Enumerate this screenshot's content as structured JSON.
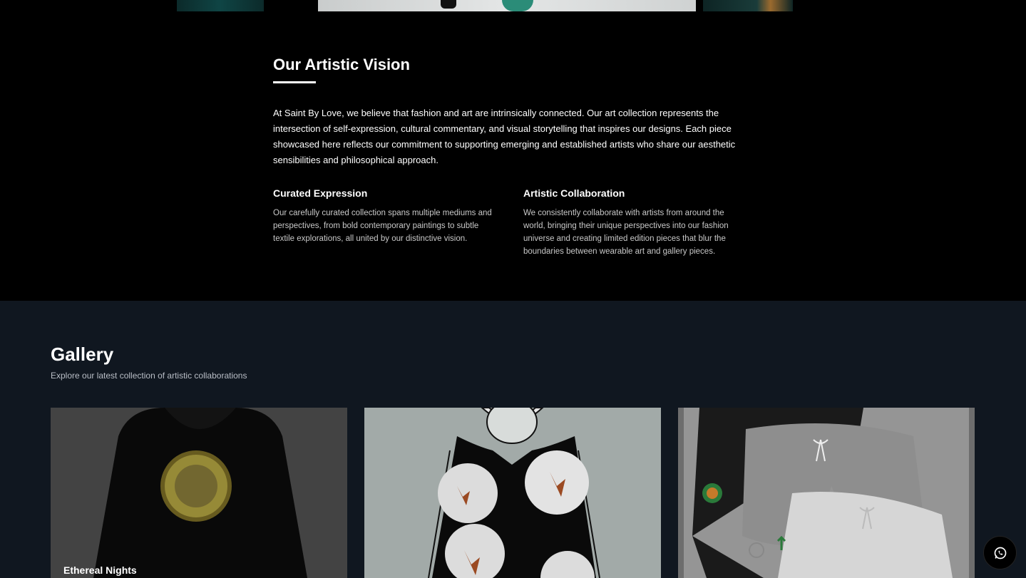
{
  "vision": {
    "title": "Our Artistic Vision",
    "intro": "At Saint By Love, we believe that fashion and art are intrinsically connected. Our art collection represents the intersection of self-expression, cultural commentary, and visual storytelling that inspires our designs. Each piece showcased here reflects our commitment to supporting emerging and established artists who share our aesthetic sensibilities and philosophical approach.",
    "features": [
      {
        "title": "Curated Expression",
        "text": "Our carefully curated collection spans multiple mediums and perspectives, from bold contemporary paintings to subtle textile explorations, all united by our distinctive vision."
      },
      {
        "title": "Artistic Collaboration",
        "text": "We consistently collaborate with artists from around the world, bringing their unique perspectives into our fashion universe and creating limited edition pieces that blur the boundaries between wearable art and gallery pieces."
      }
    ]
  },
  "gallery": {
    "title": "Gallery",
    "subtitle": "Explore our latest collection of artistic collaborations",
    "items": [
      {
        "caption": "Ethereal Nights",
        "image": "black-hoodie-with-round-art-print"
      },
      {
        "caption": "",
        "image": "black-tshirt-with-circular-eagle-prints"
      },
      {
        "caption": "",
        "image": "three-shorts-black-grey-white"
      }
    ]
  },
  "colors": {
    "vision_bg": "#000000",
    "gallery_bg": "#101720"
  },
  "icons": {
    "chat": "whatsapp-icon"
  }
}
